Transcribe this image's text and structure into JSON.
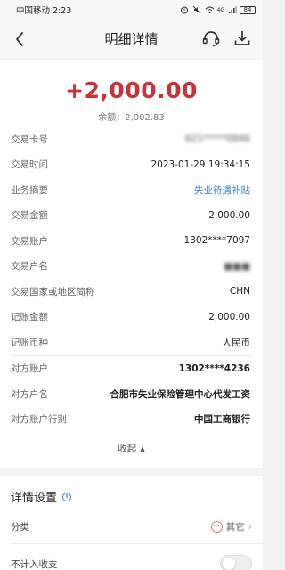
{
  "status_bar": {
    "time_carrier": "中国移动 2:23",
    "battery": "84",
    "signal_tag": "4G"
  },
  "nav": {
    "title": "明细详情"
  },
  "transaction": {
    "amount": "+2,000.00",
    "balance": "余额：2,002.83",
    "rows": [
      {
        "label": "交易卡号",
        "value": "621*****0846",
        "style": "blur"
      },
      {
        "label": "交易时间",
        "value": "2023-01-29 19:34:15",
        "style": ""
      },
      {
        "label": "业务摘要",
        "value": "失业待遇补贴",
        "style": "link"
      },
      {
        "label": "交易金额",
        "value": "2,000.00",
        "style": ""
      },
      {
        "label": "交易账户",
        "value": "1302****7097",
        "style": ""
      },
      {
        "label": "交易户名",
        "value": "■■■",
        "style": "blur"
      },
      {
        "label": "交易国家或地区简称",
        "value": "CHN",
        "style": ""
      },
      {
        "label": "记账金额",
        "value": "2,000.00",
        "style": ""
      },
      {
        "label": "记账币种",
        "value": "人民币",
        "style": ""
      },
      {
        "label": "对方账户",
        "value": "1302****4236",
        "style": "bold"
      },
      {
        "label": "对方户名",
        "value": "合肥市失业保险管理中心代发工资",
        "style": "bold"
      },
      {
        "label": "对方账户行别",
        "value": "中国工商银行",
        "style": "bold"
      }
    ],
    "collapse_label": "收起"
  },
  "settings": {
    "title": "详情设置",
    "category_label": "分类",
    "category_value": "其它",
    "exclude_label": "不计入收支"
  },
  "colors": {
    "amount": "#c8323a",
    "link": "#3f86c6",
    "info": "#3f7fd0"
  }
}
